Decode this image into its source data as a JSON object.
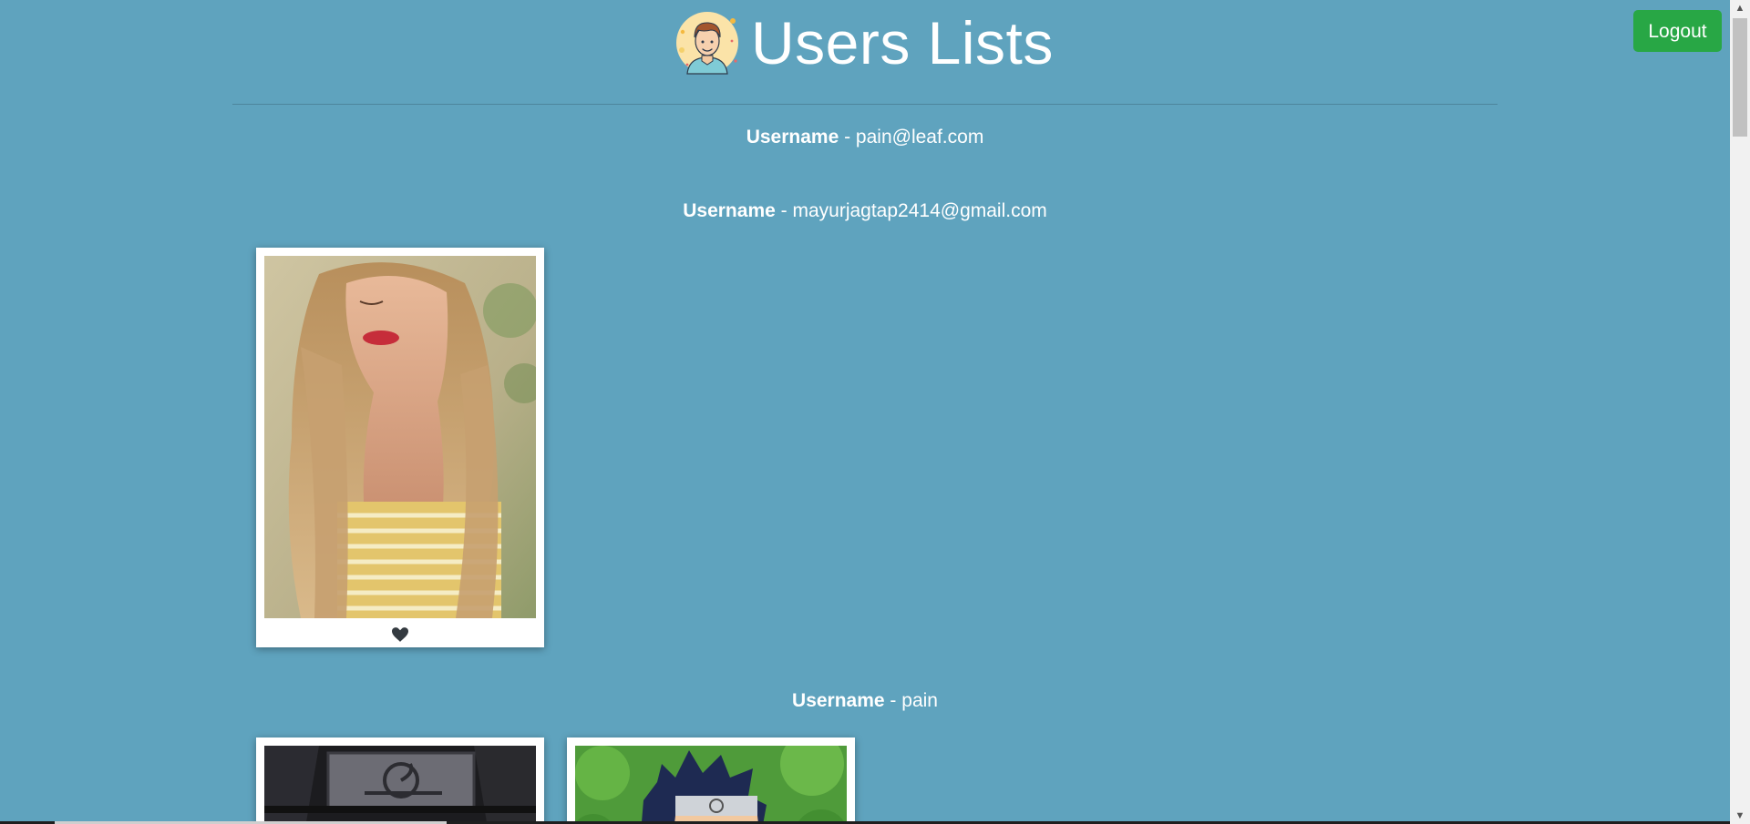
{
  "header": {
    "title": "Users Lists",
    "logout_label": "Logout"
  },
  "users": [
    {
      "label": "Username",
      "separator": " - ",
      "value": "pain@leaf.com"
    },
    {
      "label": "Username",
      "separator": " - ",
      "value": "mayurjagtap2414@gmail.com"
    },
    {
      "label": "Username",
      "separator": " - ",
      "value": "pain"
    }
  ],
  "icons": {
    "logo": "user-avatar-icon",
    "like": "heart-icon",
    "scroll_up": "chevron-up-icon",
    "scroll_down": "chevron-down-icon"
  },
  "colors": {
    "background": "#5fa3be",
    "logout_button": "#28a745",
    "heart": "#343a40",
    "text": "#ffffff"
  }
}
